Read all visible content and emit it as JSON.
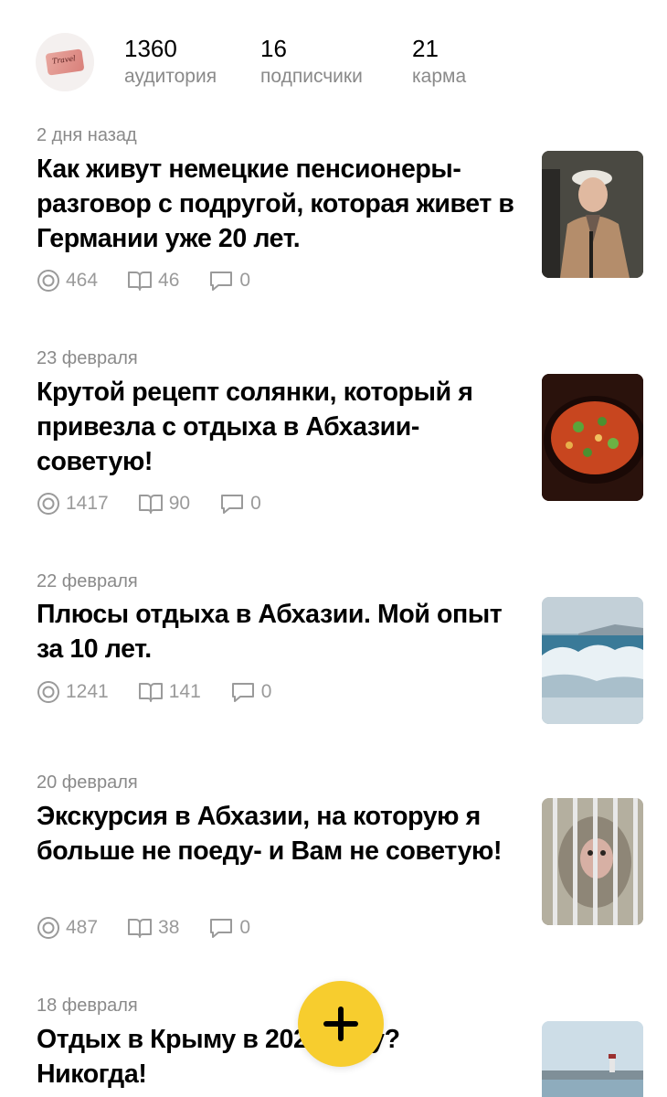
{
  "header": {
    "avatar_text": "Travel",
    "stats": [
      {
        "value": "1360",
        "label": "аудитория"
      },
      {
        "value": "16",
        "label": "подписчики"
      },
      {
        "value": "21",
        "label": "карма"
      }
    ]
  },
  "articles": [
    {
      "date": "2 дня назад",
      "title": "Как живут немецкие пенсионеры- разговор с подругой, которая живет в Германии уже 20 лет.",
      "views": "464",
      "reads": "46",
      "comments": "0",
      "thumbnail": "elderly-man-photo"
    },
    {
      "date": "23 февраля",
      "title": "Крутой рецепт солянки, который я привезла с отдыха в Абхазии- советую!",
      "views": "1417",
      "reads": "90",
      "comments": "0",
      "thumbnail": "soup-photo"
    },
    {
      "date": "22 февраля",
      "title": "Плюсы отдыха в Абхазии. Мой опыт за 10 лет.",
      "views": "1241",
      "reads": "141",
      "comments": "0",
      "thumbnail": "sea-wave-photo"
    },
    {
      "date": "20 февраля",
      "title": "Экскурсия в Абхазии, на которую я больше не поеду- и Вам не советую!",
      "views": "487",
      "reads": "38",
      "comments": "0",
      "thumbnail": "caged-monkey-photo"
    },
    {
      "date": "18 февраля",
      "title": "Отдых в Крыму в 2021 году? Никогда!",
      "thumbnail": "harbor-lighthouse-photo"
    }
  ],
  "icons": {
    "views": "eye-icon",
    "reads": "book-icon",
    "comments": "comment-icon",
    "fab": "plus-icon"
  },
  "colors": {
    "fab": "#f7cd2e",
    "secondary_text": "#8a8a8a"
  }
}
